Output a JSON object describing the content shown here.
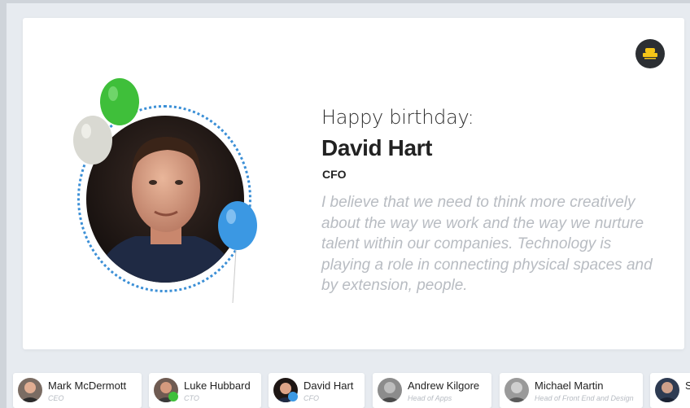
{
  "birthday": {
    "greeting": "Happy birthday:",
    "name": "David Hart",
    "role": "CFO",
    "quote": "I believe that we need to think more creatively about the way we work and the way we nurture talent within our companies. Technology is playing a role in connecting physical spaces and by extension, people."
  },
  "colors": {
    "ring": "#3b8fd6",
    "balloon_green": "#3fbf3a",
    "balloon_white": "#d9d9d2",
    "balloon_blue": "#3b98e3"
  },
  "people": [
    {
      "name": "Mark McDermott",
      "title": "CEO"
    },
    {
      "name": "Luke Hubbard",
      "title": "CTO"
    },
    {
      "name": "David Hart",
      "title": "CFO"
    },
    {
      "name": "Andrew Kilgore",
      "title": "Head of Apps"
    },
    {
      "name": "Michael Martin",
      "title": "Head of Front End and Design"
    },
    {
      "name": "S",
      "title": ""
    }
  ]
}
